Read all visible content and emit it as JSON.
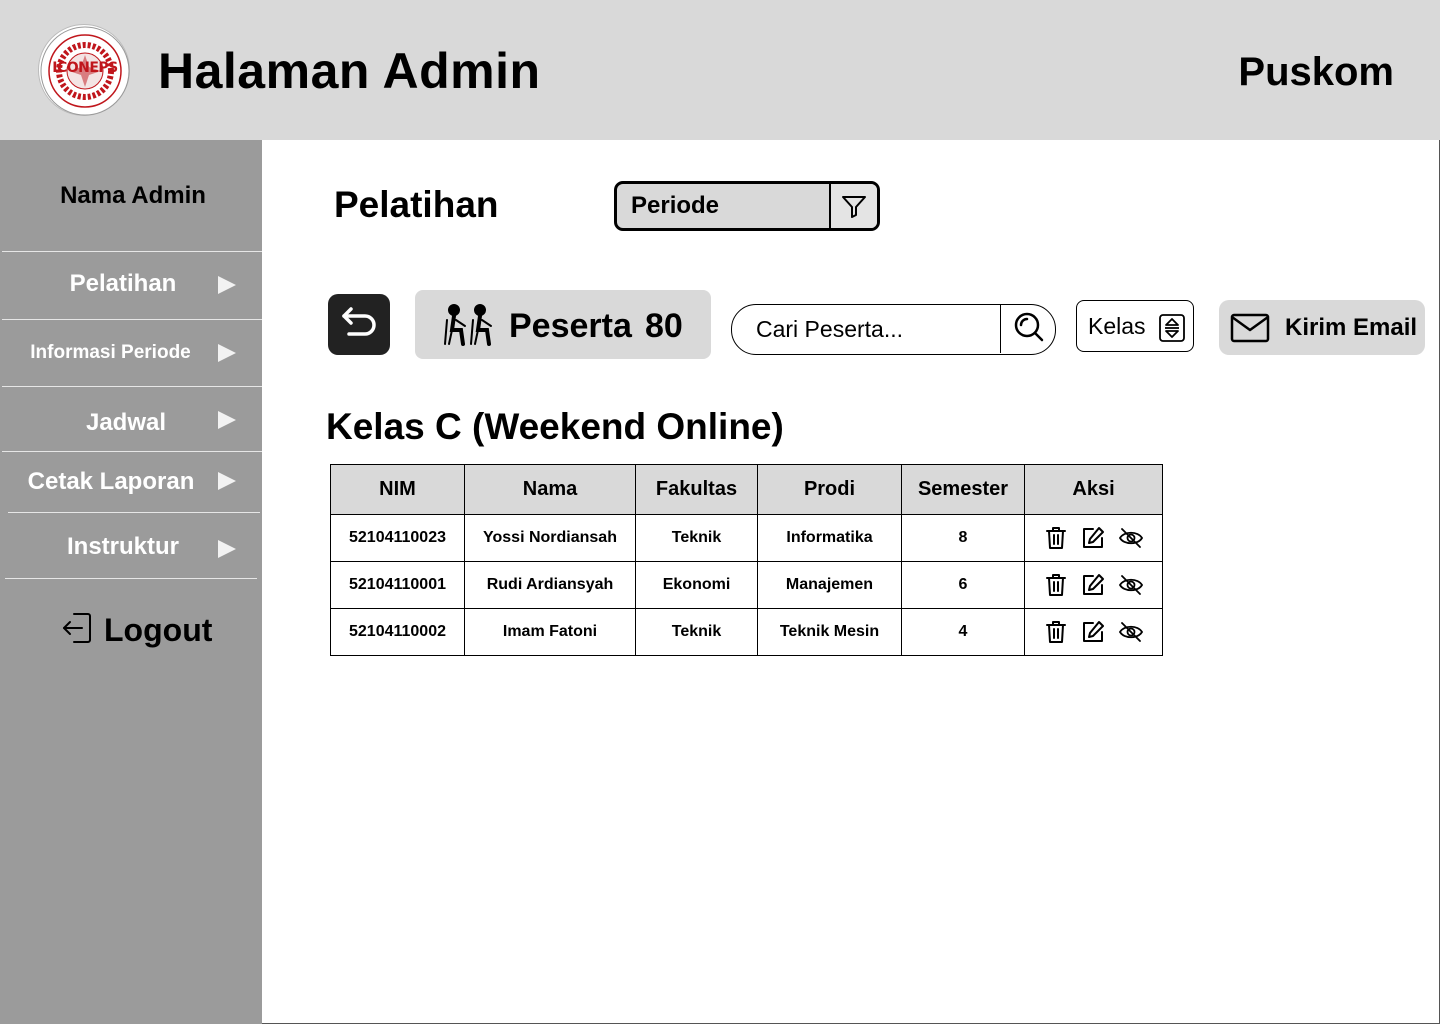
{
  "header": {
    "logo_text": "ICONEPS",
    "logo_ring_text": "INSTITUTE FOR CONTINUING EDUCATION AND PROFESSIONAL SERVICES",
    "title": "Halaman Admin",
    "org": "Puskom"
  },
  "sidebar": {
    "admin_name": "Nama Admin",
    "items": [
      {
        "label": "Pelatihan",
        "icon": "triangle-right-icon"
      },
      {
        "label": "Informasi Periode",
        "icon": "triangle-right-icon"
      },
      {
        "label": "Jadwal",
        "icon": "triangle-right-icon"
      },
      {
        "label": "Cetak Laporan",
        "icon": "triangle-right-icon"
      },
      {
        "label": "Instruktur",
        "icon": "triangle-right-icon"
      }
    ],
    "logout": {
      "label": "Logout",
      "icon": "logout-icon"
    }
  },
  "main": {
    "page_title": "Pelatihan",
    "period_select": {
      "value": "Periode",
      "icon": "filter-icon"
    },
    "back_button": {
      "icon": "back-arrow-icon"
    },
    "peserta": {
      "label": "Peserta",
      "count": "80",
      "icon": "participants-icon"
    },
    "search": {
      "placeholder": "Cari Peserta...",
      "icon": "search-icon"
    },
    "kelas_select": {
      "value": "Kelas",
      "icon": "sort-icon"
    },
    "email_button": {
      "label": "Kirim Email",
      "icon": "mail-icon"
    },
    "class_title": "Kelas C (Weekend Online)",
    "table": {
      "columns": [
        "NIM",
        "Nama",
        "Fakultas",
        "Prodi",
        "Semester",
        "Aksi"
      ],
      "rows": [
        {
          "nim": "52104110023",
          "nama": "Yossi Nordiansah",
          "fakultas": "Teknik",
          "prodi": "Informatika",
          "semester": "8"
        },
        {
          "nim": "52104110001",
          "nama": "Rudi Ardiansyah",
          "fakultas": "Ekonomi",
          "prodi": "Manajemen",
          "semester": "6"
        },
        {
          "nim": "52104110002",
          "nama": "Imam Fatoni",
          "fakultas": "Teknik",
          "prodi": "Teknik Mesin",
          "semester": "4"
        }
      ],
      "action_icons": [
        "trash-icon",
        "edit-icon",
        "eye-off-icon"
      ]
    }
  },
  "colors": {
    "header_bg": "#d9d9d9",
    "sidebar_bg": "#9b9b9b",
    "logo_red": "#c0161c",
    "back_button_bg": "#222222"
  }
}
